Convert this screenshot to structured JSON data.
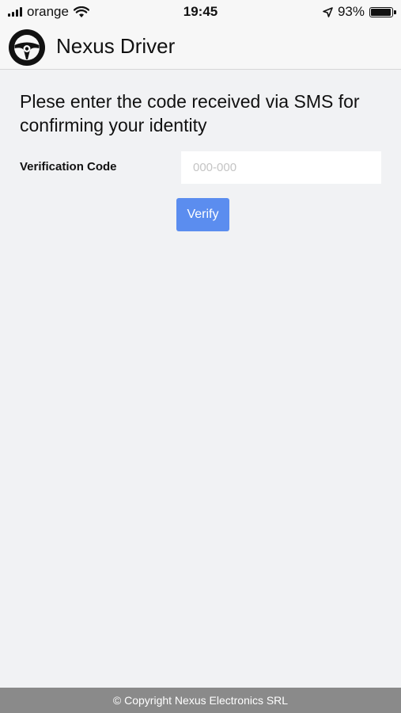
{
  "status_bar": {
    "carrier": "orange",
    "time": "19:45",
    "battery_percent": "93%",
    "battery_level": 0.93,
    "icons": [
      "signal-icon",
      "wifi-icon",
      "location-arrow-icon",
      "battery-icon"
    ]
  },
  "app": {
    "title": "Nexus Driver",
    "logo_icon": "steering-wheel-icon"
  },
  "main": {
    "instruction": "Plese enter the code received via SMS for confirming your identity",
    "field_label": "Verification Code",
    "code_placeholder": "000-000",
    "code_value": "",
    "verify_label": "Verify"
  },
  "footer": {
    "copyright": "© Copyright Nexus Electronics SRL"
  },
  "colors": {
    "accent": "#5b8def",
    "background": "#f1f2f4",
    "footer": "#8a8a8a"
  }
}
